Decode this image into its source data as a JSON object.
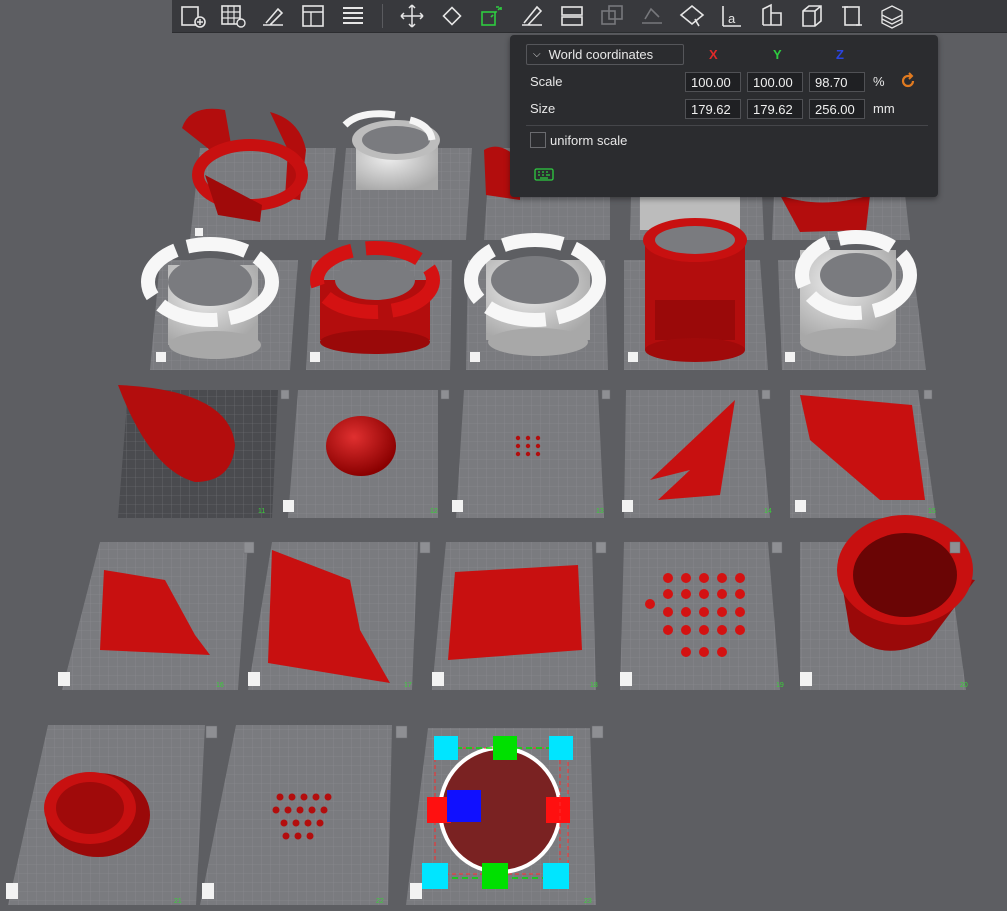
{
  "toolbar": {
    "buttons": [
      "add-plate-icon",
      "arrange-grid-icon",
      "auto-orient-icon",
      "layout-icon",
      "layers-icon",
      "move-icon",
      "rotate-icon",
      "scale-icon",
      "cut-icon",
      "split-icon",
      "boolean-icon",
      "support-paint-icon",
      "seam-paint-icon",
      "text-icon",
      "measure-icon",
      "assemble-icon",
      "variable-layer-icon",
      "slice-icon"
    ]
  },
  "scale_panel": {
    "coordinate_mode": "World coordinates",
    "axes": {
      "x": "X",
      "y": "Y",
      "z": "Z"
    },
    "axis_colors": {
      "x": "#e02a2a",
      "y": "#2ecc40",
      "z": "#2a44e0"
    },
    "scale": {
      "label": "Scale",
      "x": "100.00",
      "y": "100.00",
      "z": "98.70",
      "unit": "%"
    },
    "size": {
      "label": "Size",
      "x": "179.62",
      "y": "179.62",
      "z": "256.00",
      "unit": "mm"
    },
    "uniform_scale": {
      "label": "uniform scale",
      "checked": false
    }
  },
  "plates": {
    "numbers": [
      "11",
      "12",
      "13",
      "14",
      "15",
      "16",
      "17",
      "18",
      "19",
      "20",
      "21",
      "22",
      "23"
    ]
  },
  "colors": {
    "background": "#5d5e62",
    "plate": "#7a7b7f",
    "part_red": "#c81010",
    "part_white": "#d8d8d8",
    "handle_cyan": "#00e5ff",
    "handle_green": "#00e000",
    "handle_red": "#ff1010",
    "handle_blue": "#1010ff",
    "accent_orange": "#e07a20"
  }
}
